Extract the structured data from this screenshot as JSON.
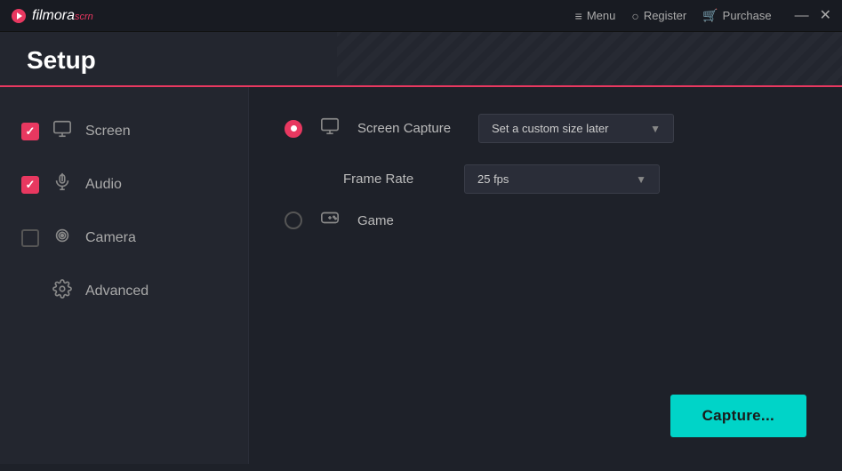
{
  "titlebar": {
    "logo_filmora": "filmora",
    "logo_scrn": "scrn",
    "menu_label": "Menu",
    "register_label": "Register",
    "purchase_label": "Purchase",
    "minimize_icon": "—",
    "close_icon": "✕"
  },
  "header": {
    "title": "Setup"
  },
  "sidebar": {
    "items": [
      {
        "id": "screen",
        "label": "Screen",
        "checked": true,
        "icon": "screen"
      },
      {
        "id": "audio",
        "label": "Audio",
        "checked": true,
        "icon": "audio"
      },
      {
        "id": "camera",
        "label": "Camera",
        "checked": false,
        "icon": "camera"
      },
      {
        "id": "advanced",
        "label": "Advanced",
        "checked": false,
        "icon": "gear"
      }
    ]
  },
  "right_panel": {
    "screen_capture_label": "Screen Capture",
    "screen_capture_value": "Set a custom size later",
    "frame_rate_label": "Frame Rate",
    "frame_rate_value": "25 fps",
    "game_label": "Game",
    "capture_button": "Capture..."
  }
}
